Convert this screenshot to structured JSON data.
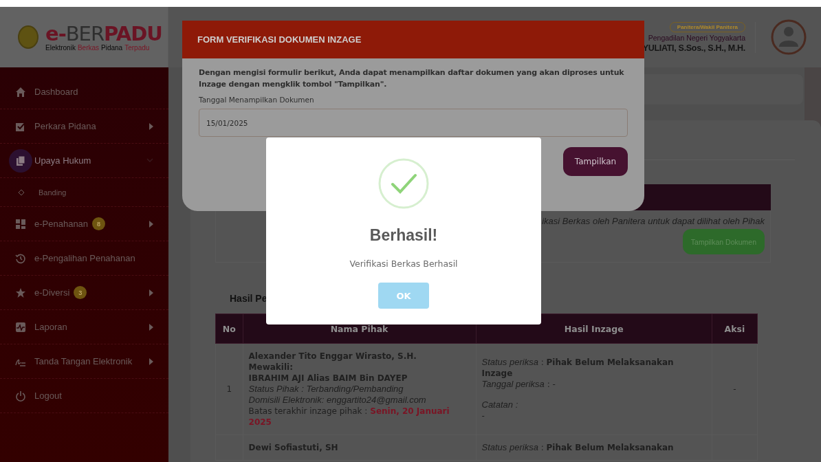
{
  "header": {
    "logo_parts": [
      {
        "text": "e-",
        "color": "#6a1424"
      },
      {
        "text": "BER",
        "color": "#2e2e2e"
      },
      {
        "text": "PADU",
        "color": "#6a1424"
      }
    ],
    "tagline_parts": [
      {
        "text": "Elektronik",
        "color": "#0a0a0a"
      },
      {
        "text": "Berkas",
        "color": "#7a1424"
      },
      {
        "text": "Pidana",
        "color": "#0a0a0a"
      },
      {
        "text": "Terpadu",
        "color": "#7a1424"
      }
    ],
    "role": "Panitera/Wakil Panitera",
    "court": "Pengadilan Negeri Yogyakarta",
    "user_name": "YULIATI, S.Sos., S.H., M.H."
  },
  "sidebar": {
    "items": [
      {
        "label": "Dashboard",
        "selected": false,
        "arrow": false
      },
      {
        "label": "Perkara Pidana",
        "selected": false,
        "arrow": true
      },
      {
        "label": "Upaya Hukum",
        "selected": true,
        "arrow": false,
        "expanded": true,
        "children": [
          {
            "label": "Banding",
            "selected": false
          }
        ]
      },
      {
        "label": "e-Penahanan",
        "selected": false,
        "arrow": true,
        "badge": "8"
      },
      {
        "label": "e-Pengalihan Penahanan",
        "selected": false,
        "arrow": false
      },
      {
        "label": "e-Diversi",
        "selected": false,
        "arrow": true,
        "badge": "3"
      },
      {
        "label": "Laporan",
        "selected": false,
        "arrow": true
      },
      {
        "label": "Tanda Tangan Elektronik",
        "selected": false,
        "arrow": true
      },
      {
        "label": "Logout",
        "selected": false,
        "arrow": false
      }
    ]
  },
  "panel": {
    "note": "ikasi Berkas oleh Panitera untuk dapat dilihat oleh Pihak",
    "button": "Tampilkan Dokumen"
  },
  "section_title": "Hasil Pe",
  "table": {
    "columns": [
      "No",
      "Nama Pihak",
      "Hasil Inzage",
      "Aksi"
    ],
    "rows": [
      {
        "no": "1",
        "name_lines": [
          {
            "kind": "strong",
            "text": "Alexander Tito Enggar Wirasto, S.H."
          },
          {
            "kind": "strong",
            "text": "Mewakili:"
          },
          {
            "kind": "strong",
            "text": "IBRAHIM AJI Alias BAIM Bin DAYEP"
          },
          {
            "kind": "italic",
            "text": "Status Pihak : Terbanding/Pembanding"
          },
          {
            "kind": "italic",
            "text": "Domisili Elektronik: enggartito24@gmail.com"
          },
          {
            "kind": "plain",
            "text": "Batas terakhir inzage pihak : **Senin, 20 Januari 2025**"
          }
        ],
        "result_lines": [
          {
            "kind": "plain",
            "text": "*Status periksa* : **Pihak Belum Melaksanakan Inzage**"
          },
          {
            "kind": "plain",
            "text": "*Tanggal periksa* : -"
          },
          {
            "kind": "gap"
          },
          {
            "kind": "italic",
            "text": "Catatan :"
          },
          {
            "kind": "plain",
            "text": "-"
          }
        ],
        "action": "-"
      },
      {
        "name_lines": [
          {
            "kind": "strong",
            "text": "Dewi Sofiastuti, SH"
          }
        ],
        "result_lines": [
          {
            "kind": "plain",
            "text": "*Status periksa* : **Pihak Belum Melaksanakan**"
          }
        ]
      }
    ]
  },
  "form_modal": {
    "title": "FORM VERIFIKASI DOKUMEN INZAGE",
    "intro": "Dengan mengisi formulir berikut, Anda dapat menampilkan daftar dokumen yang akan diproses untuk Inzage dengan mengklik tombol \"Tampilkan\".",
    "field_label": "Tanggal Menampilkan Dokumen",
    "field_value": "15/01/2025",
    "button": "Tampilkan"
  },
  "success_modal": {
    "title": "Berhasil!",
    "message": "Verifikasi Berkas Berhasil",
    "button": "OK"
  }
}
